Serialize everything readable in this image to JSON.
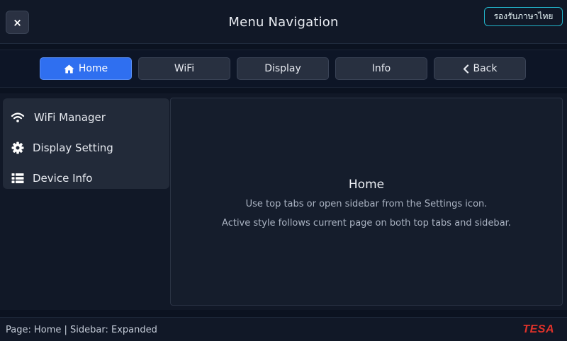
{
  "header": {
    "close_icon": "close-icon",
    "close_label": "×",
    "title": "Menu Navigation",
    "language_button": "รองรับภาษาไทย"
  },
  "tabs": [
    {
      "label": "Home",
      "icon": "home-icon",
      "active": true
    },
    {
      "label": "WiFi",
      "active": false
    },
    {
      "label": "Display",
      "active": false
    },
    {
      "label": "Info",
      "active": false
    },
    {
      "label": "Back",
      "icon": "chevron-left-icon",
      "active": false
    }
  ],
  "sidebar": {
    "items": [
      {
        "label": "WiFi Manager",
        "icon": "wifi-icon"
      },
      {
        "label": "Display Setting",
        "icon": "gear-icon"
      },
      {
        "label": "Device Info",
        "icon": "list-icon"
      }
    ]
  },
  "main": {
    "title": "Home",
    "line1": "Use top tabs or open sidebar from the Settings icon.",
    "line2": "Active style follows current page on both top tabs and sidebar."
  },
  "status": {
    "text": "Page: Home | Sidebar: Expanded",
    "brand": "TESA"
  },
  "colors": {
    "background": "#0b1220",
    "accent": "#2f6ff0",
    "language_border": "#22b3c9",
    "brand": "#e0322a"
  }
}
